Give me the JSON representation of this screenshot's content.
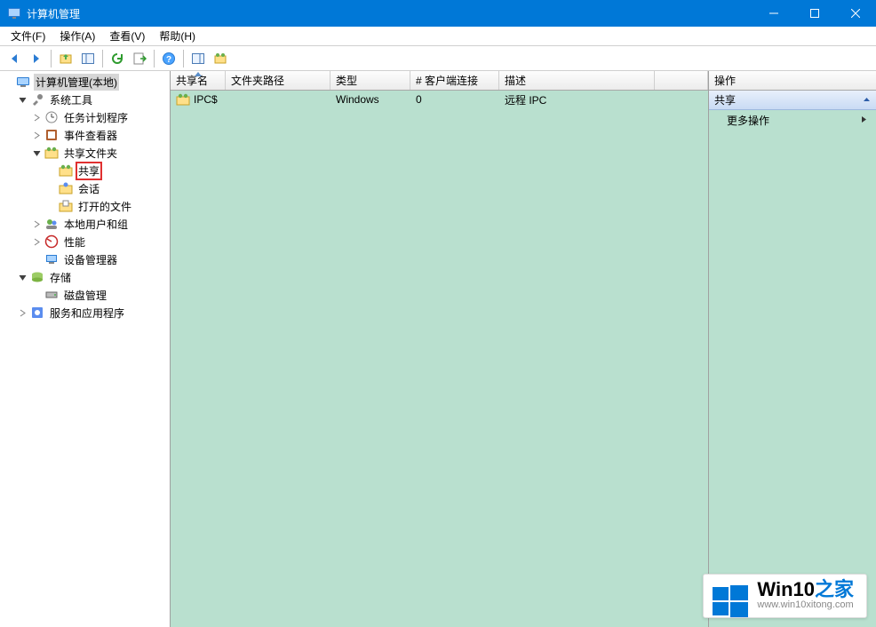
{
  "window": {
    "title": "计算机管理"
  },
  "menu": {
    "file": "文件(F)",
    "action": "操作(A)",
    "view": "查看(V)",
    "help": "帮助(H)"
  },
  "tree": {
    "root": "计算机管理(本地)",
    "system_tools": "系统工具",
    "task_scheduler": "任务计划程序",
    "event_viewer": "事件查看器",
    "shared_folders": "共享文件夹",
    "shares": "共享",
    "sessions": "会话",
    "open_files": "打开的文件",
    "local_users": "本地用户和组",
    "performance": "性能",
    "device_manager": "设备管理器",
    "storage": "存储",
    "disk_management": "磁盘管理",
    "services_apps": "服务和应用程序"
  },
  "columns": {
    "share_name": "共享名",
    "folder_path": "文件夹路径",
    "type": "类型",
    "client_connections": "# 客户端连接",
    "description": "描述"
  },
  "rows": [
    {
      "name": "IPC$",
      "path": "",
      "type": "Windows",
      "clients": "0",
      "desc": "远程 IPC"
    }
  ],
  "actions": {
    "header": "操作",
    "section": "共享",
    "more": "更多操作"
  },
  "watermark": {
    "title_a": "Win10",
    "title_b": "之家",
    "url": "www.win10xitong.com"
  }
}
